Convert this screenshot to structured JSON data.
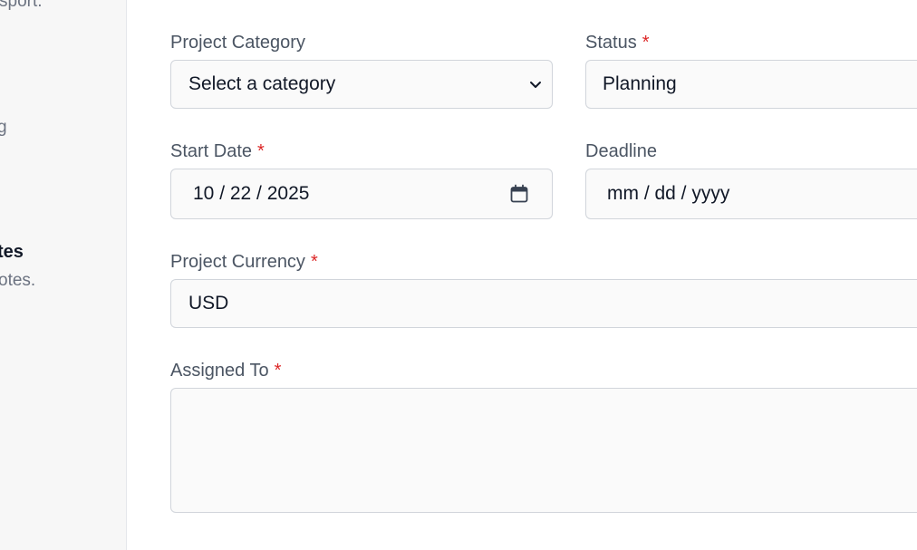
{
  "sidebar": {
    "fragments": {
      "top": "sport.",
      "middle": "g",
      "section_title": "tes",
      "section_desc": "otes."
    }
  },
  "form": {
    "category": {
      "label": "Project Category",
      "selected": "Select a category",
      "required": false
    },
    "status": {
      "label": "Status",
      "required_mark": "*",
      "value": "Planning"
    },
    "start_date": {
      "label": "Start Date",
      "required_mark": "*",
      "value": "10 / 22 / 2025"
    },
    "deadline": {
      "label": "Deadline",
      "placeholder": "mm / dd / yyyy"
    },
    "currency": {
      "label": "Project Currency",
      "required_mark": "*",
      "value": "USD"
    },
    "assigned_to": {
      "label": "Assigned To",
      "required_mark": "*",
      "value": ""
    }
  },
  "colors": {
    "required": "#dc2626",
    "label": "#4b5563",
    "input_bg": "#fafafa",
    "border": "#d1d5db",
    "sidebar_bg": "#f7f7f7"
  },
  "icons": {
    "select_chevron": "chevron-down-icon",
    "date_picker": "calendar-icon"
  }
}
